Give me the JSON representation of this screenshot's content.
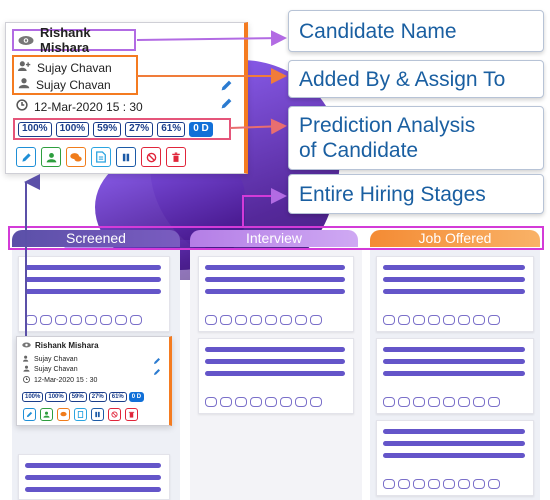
{
  "callouts": {
    "candidate_name": "Candidate Name",
    "added_assign": "Added By & Assign To",
    "prediction_line1": "Prediction Analysis",
    "prediction_line2": "of Candidate",
    "hiring_stages": "Entire Hiring Stages"
  },
  "card": {
    "candidate_name": "Rishank Mishara",
    "added_by": "Sujay Chavan",
    "assigned_to": "Sujay Chavan",
    "date": "12-Mar-2020 15 : 30",
    "predictions": [
      "100%",
      "100%",
      "59%",
      "27%",
      "61%"
    ],
    "days_badge": "0 D",
    "icons": {
      "view": "eye-icon",
      "added_by": "user-plus-icon",
      "assigned_to": "user-icon",
      "date": "clock-icon",
      "edit": "pencil-icon"
    },
    "actions": [
      {
        "icon": "edit-icon",
        "color": "#1f8fd6"
      },
      {
        "icon": "user-icon",
        "color": "#2e9e3e"
      },
      {
        "icon": "chat-icon",
        "color": "#f07c1b"
      },
      {
        "icon": "document-icon",
        "color": "#2ba4e0"
      },
      {
        "icon": "pause-icon",
        "color": "#1c5aa6"
      },
      {
        "icon": "block-icon",
        "color": "#e0253a"
      },
      {
        "icon": "trash-icon",
        "color": "#e0253a"
      }
    ]
  },
  "stages": [
    "Screened",
    "Interview",
    "Job Offered"
  ],
  "colors": {
    "accent_orange": "#f47b20",
    "callout_text": "#1a5fa1",
    "highlight_purple": "#b26be3",
    "highlight_pink": "#e5557a",
    "stage_frame": "#d33bd8"
  }
}
